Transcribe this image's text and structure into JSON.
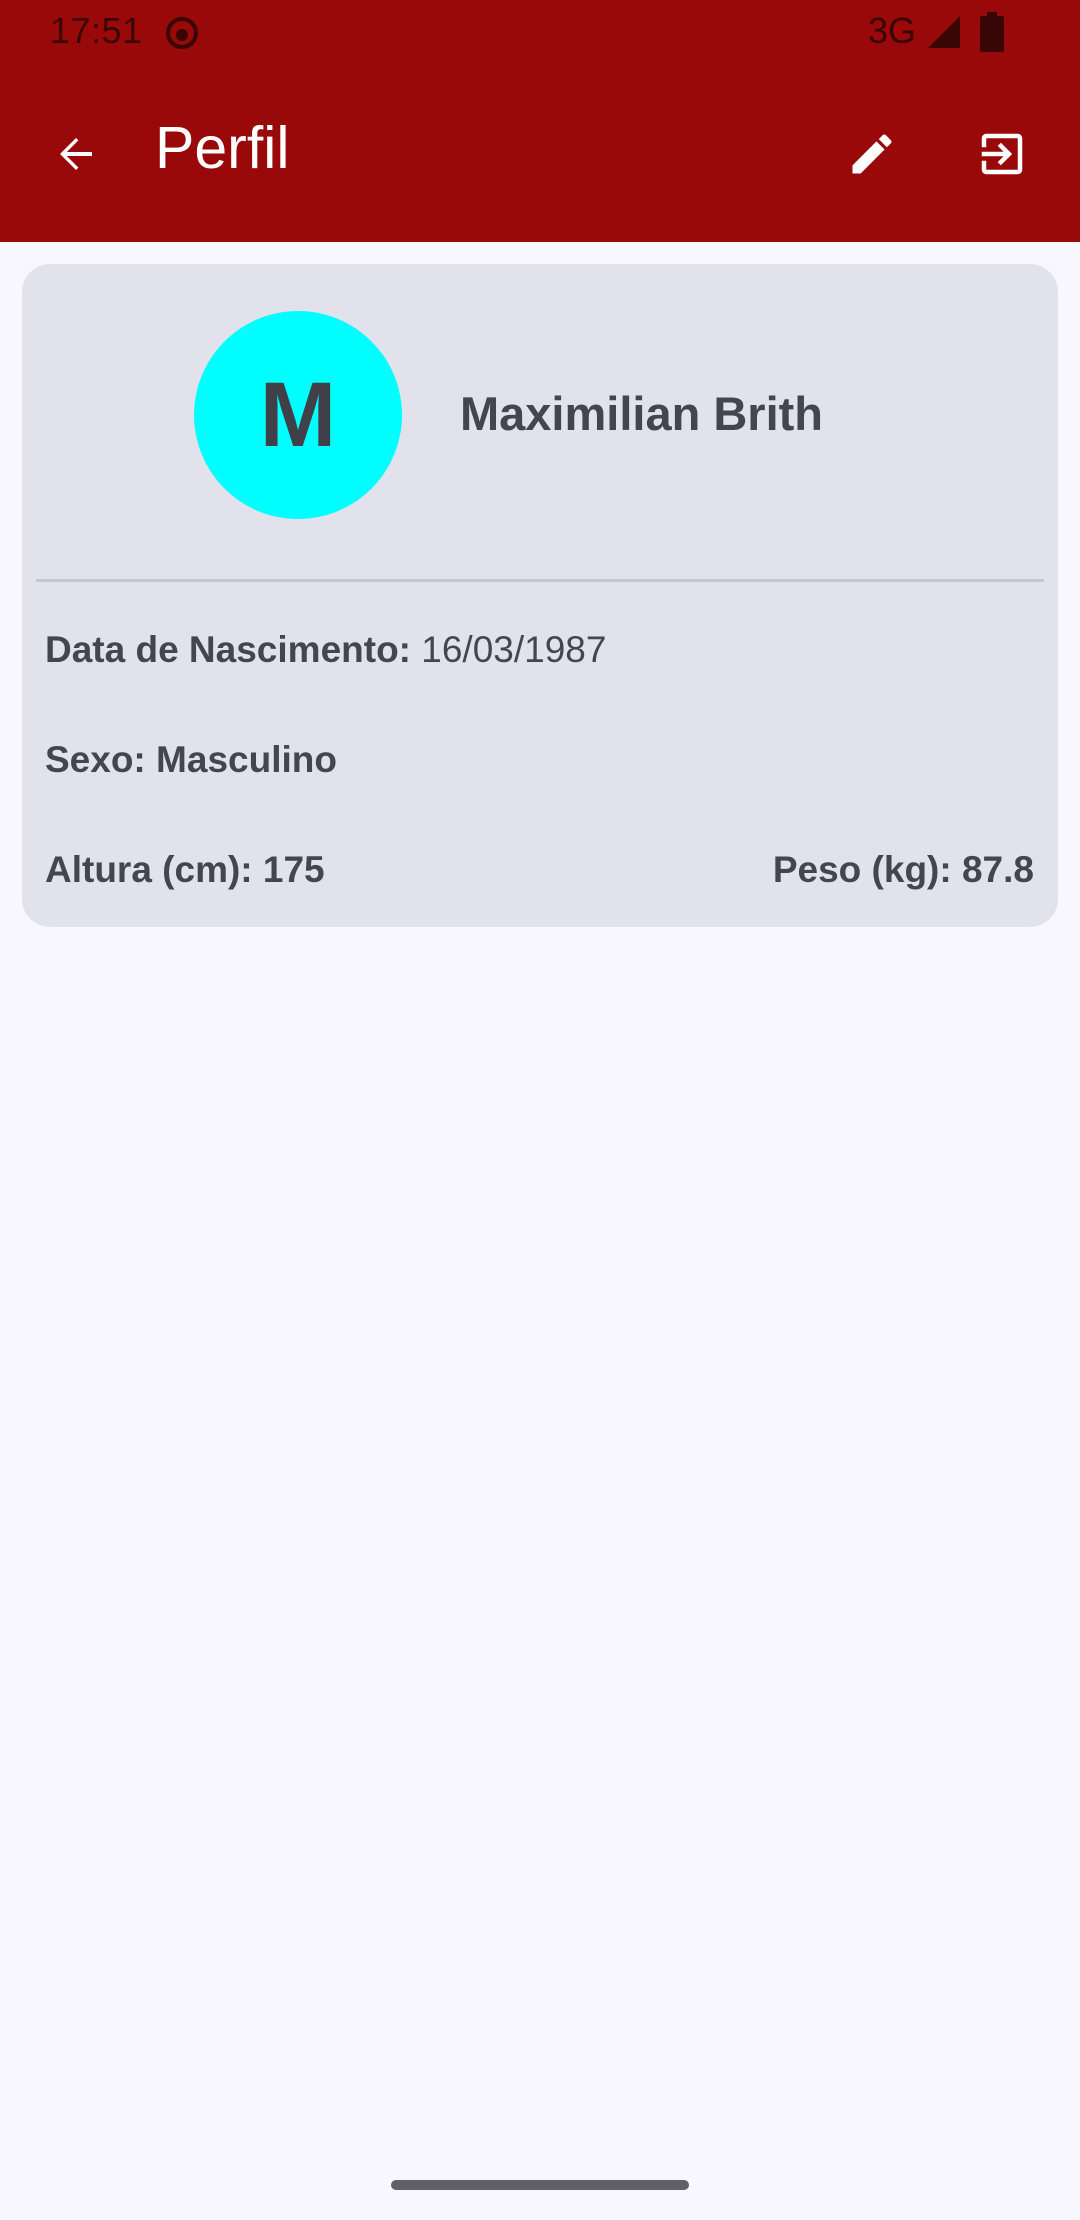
{
  "status_bar": {
    "time": "17:51",
    "network": "3G",
    "icons": [
      "app-notification-icon",
      "signal-icon",
      "battery-icon"
    ]
  },
  "app_bar": {
    "title": "Perfil",
    "icons": [
      "back-arrow-icon",
      "edit-pencil-icon",
      "logout-icon"
    ]
  },
  "profile": {
    "initial": "M",
    "name": "Maximilian Brith",
    "birth_label": "Data de Nascimento:",
    "birth_value": "16/03/1987",
    "sex_label": "Sexo:",
    "sex_value": "Masculino",
    "height_label": "Altura (cm):",
    "height_value": "175",
    "weight_label": "Peso (kg):",
    "weight_value": "87.8"
  },
  "colors": {
    "app_bar": "#990909",
    "background": "#F7F7FD",
    "card": "#E1E2EC",
    "avatar": "#00FFFF",
    "text": "#44464F"
  }
}
